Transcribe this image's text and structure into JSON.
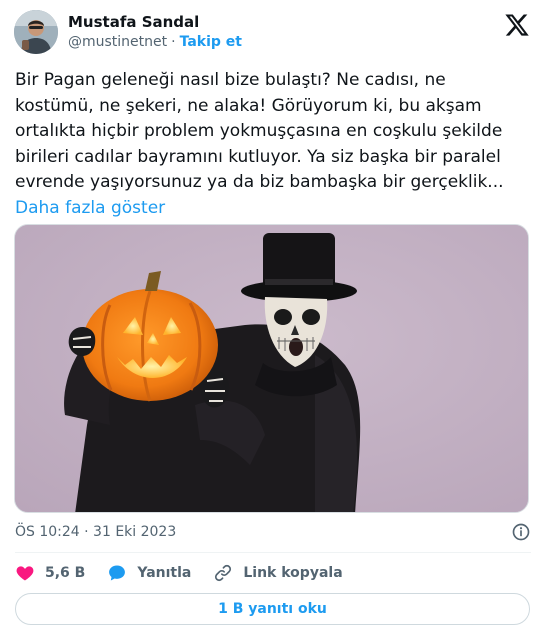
{
  "author": {
    "name": "Mustafa Sandal",
    "handle": "@mustinetnet",
    "separator": "·",
    "follow_label": "Takip et"
  },
  "tweet": {
    "text": "Bir Pagan geleneği nasıl bize bulaştı? Ne cadısı, ne kostümü, ne şekeri, ne alaka! Görüyorum ki, bu akşam ortalıkta hiçbir problem yokmuşçasına en coşkulu şekilde birileri cadılar bayramını kutluyor. Ya siz başka bir paralel evrende yaşıyorsunuz ya da biz bambaşka bir gerçeklik...",
    "show_more_label": "Daha fazla göster",
    "timestamp": "ÖS 10:24 · 31 Eki 2023"
  },
  "actions": {
    "like_count": "5,6 B",
    "reply_label": "Yanıtla",
    "copy_link_label": "Link kopyala"
  },
  "replies_button_label": "1 B yanıtı oku",
  "icons": {
    "logo": "x-logo-icon",
    "info": "info-icon",
    "like": "heart-icon",
    "reply": "speech-bubble-icon",
    "link": "link-icon"
  },
  "colors": {
    "accent": "#1d9bf0",
    "like": "#f91880",
    "text": "#0f1419",
    "muted": "#536471",
    "media_background": "#c5b4c6"
  }
}
